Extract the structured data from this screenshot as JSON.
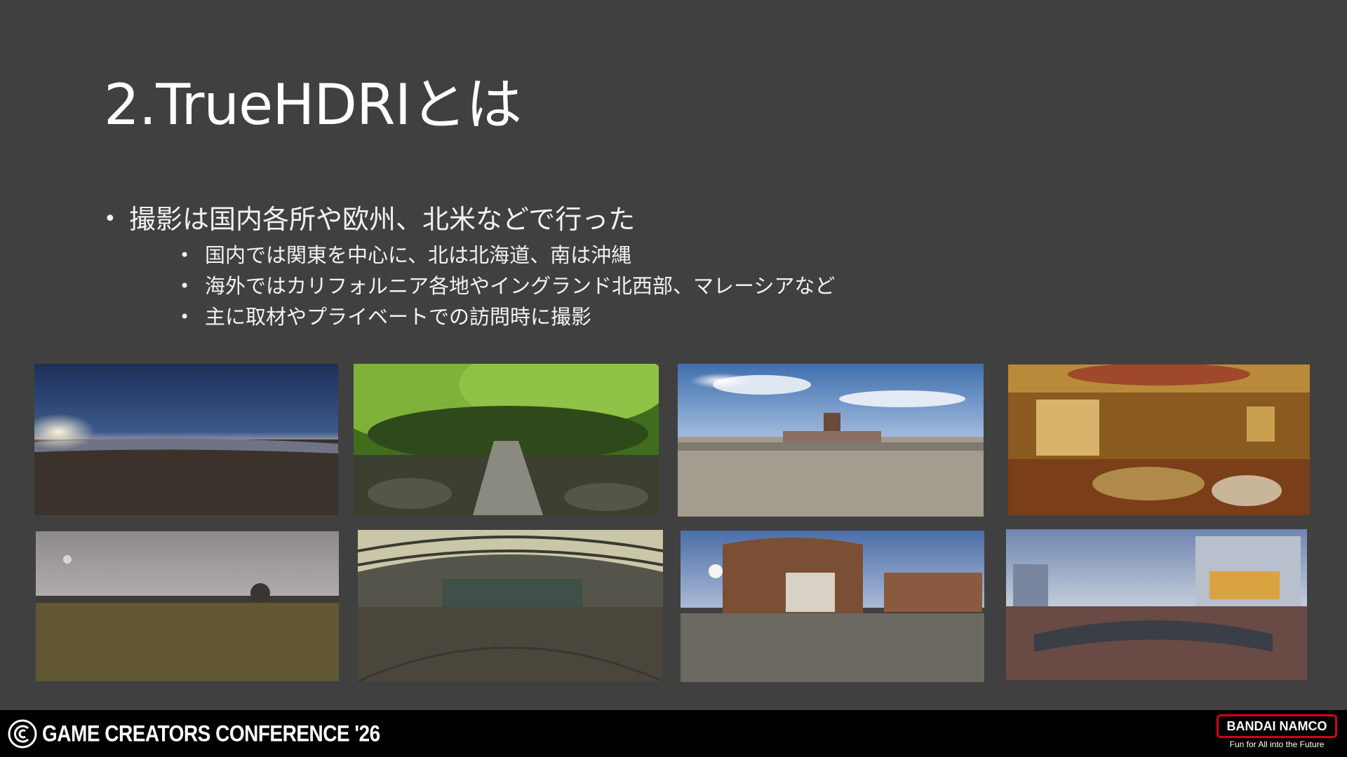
{
  "slide": {
    "title": "2.TrueHDRIとは",
    "bullet_main": "撮影は国内各所や欧州、北米などで行った",
    "sub_bullets": [
      "国内では関東を中心に、北は北海道、南は沖縄",
      "海外ではカリフォルニア各地やイングランド北西部、マレーシアなど",
      "主に取材やプライベートでの訪問時に撮影"
    ]
  },
  "footer": {
    "conference": "GAME CREATORS CONFERENCE '26",
    "company": "BANDAI NAMCO",
    "tagline": "Fun for All into the Future"
  },
  "colors": {
    "background": "#404040",
    "footer": "#000000",
    "brand_red": "#d0021b"
  }
}
